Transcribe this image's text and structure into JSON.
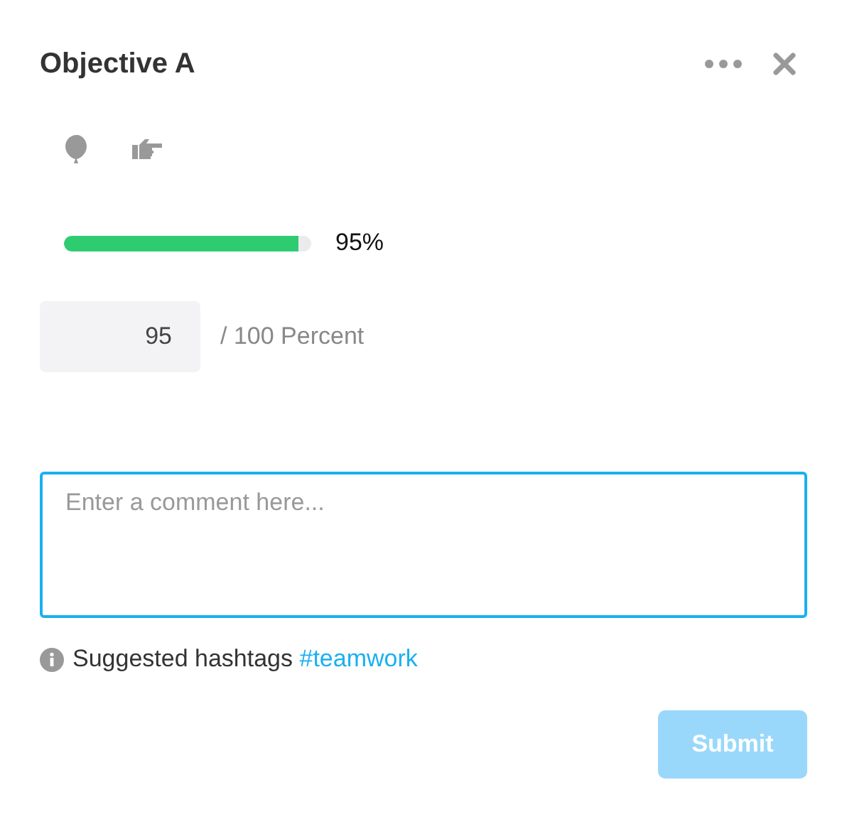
{
  "header": {
    "title": "Objective A"
  },
  "progress": {
    "level": 0.95,
    "reading": "95%"
  },
  "value_field": {
    "value": "95",
    "suffix": "/ 100 Percent"
  },
  "comment": {
    "placeholder": "Enter a comment here...",
    "focused": true
  },
  "hint": {
    "label": "Suggested hashtags",
    "hashtag": "#teamwork"
  },
  "submit": {
    "label": "Submit",
    "disabled": true
  }
}
